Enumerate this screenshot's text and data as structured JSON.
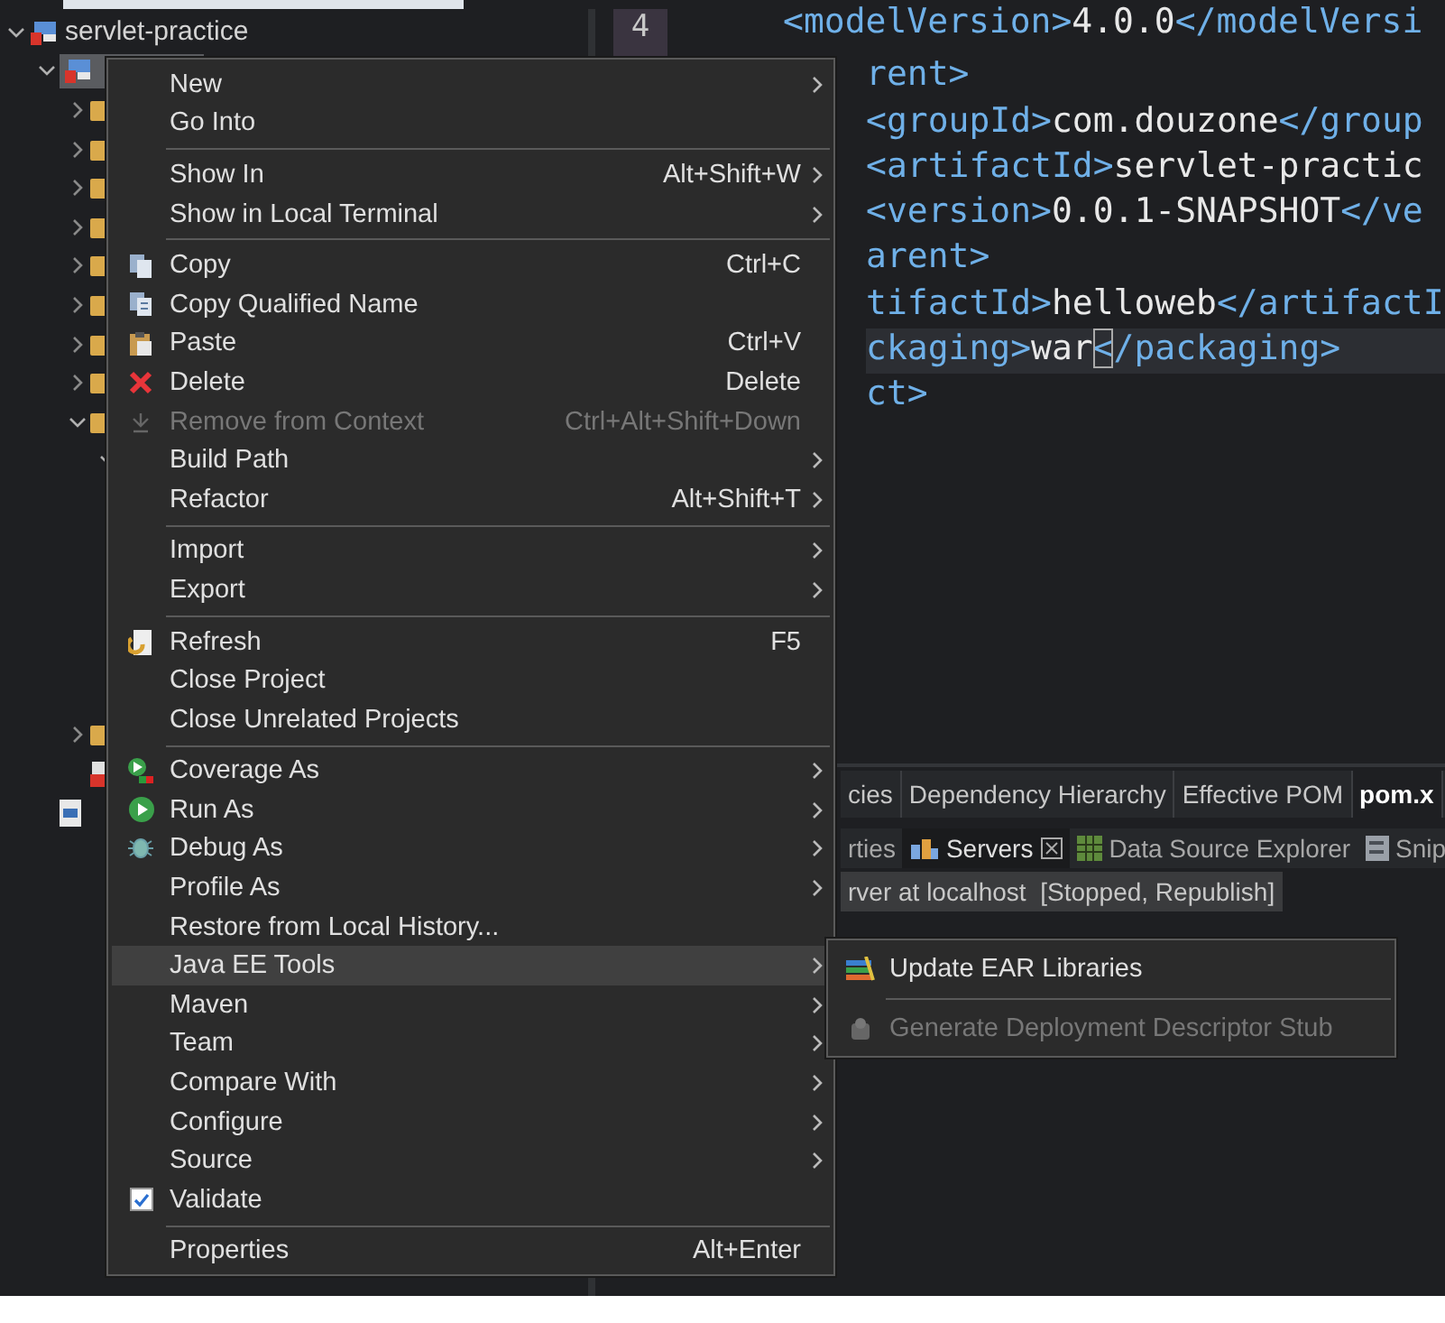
{
  "explorer": {
    "tree": [
      {
        "label": "servlet-practice",
        "expanded": true,
        "selected": false,
        "children": [
          {
            "expanded": true,
            "selected": true,
            "children": [
              {
                "expanded": false,
                "selected": false
              },
              {
                "expanded": false,
                "selected": false
              },
              {
                "expanded": false,
                "selected": false
              },
              {
                "expanded": false,
                "selected": false
              },
              {
                "expanded": false,
                "selected": false
              },
              {
                "expanded": false,
                "selected": false
              },
              {
                "expanded": false,
                "selected": false
              },
              {
                "expanded": false,
                "selected": false
              },
              {
                "expanded": true,
                "selected": false,
                "children": [
                  {
                    "expanded": true,
                    "selected": false
                  }
                ]
              },
              {
                "expanded": false,
                "selected": false
              },
              {
                "kind": "file",
                "selected": false
              }
            ]
          },
          {
            "kind": "pom",
            "selected": false
          }
        ]
      }
    ]
  },
  "editor": {
    "line_numbers": [
      "4"
    ],
    "lines": [
      {
        "current": false,
        "segments": [
          {
            "kind": "tag",
            "text": "<modelVersion>"
          },
          {
            "kind": "text",
            "text": "4.0.0"
          },
          {
            "kind": "tag",
            "text": "</modelVersi"
          }
        ]
      },
      {
        "current": false,
        "segments": [
          {
            "kind": "tag",
            "text": "rent>"
          }
        ]
      },
      {
        "current": false,
        "segments": [
          {
            "kind": "tag",
            "text": "<groupId>"
          },
          {
            "kind": "text",
            "text": "com.douzone"
          },
          {
            "kind": "tag",
            "text": "</group"
          }
        ]
      },
      {
        "current": false,
        "segments": [
          {
            "kind": "tag",
            "text": "<artifactId>"
          },
          {
            "kind": "text",
            "text": "servlet-practic"
          }
        ]
      },
      {
        "current": false,
        "segments": [
          {
            "kind": "tag",
            "text": "<version>"
          },
          {
            "kind": "text",
            "text": "0.0.1-SNAPSHOT"
          },
          {
            "kind": "tag",
            "text": "</ve"
          }
        ]
      },
      {
        "current": false,
        "segments": [
          {
            "kind": "tag",
            "text": "arent>"
          }
        ]
      },
      {
        "current": false,
        "segments": [
          {
            "kind": "tag",
            "text": "tifactId>"
          },
          {
            "kind": "text",
            "text": "helloweb"
          },
          {
            "kind": "tag",
            "text": "</artifactI"
          }
        ]
      },
      {
        "current": true,
        "segments": [
          {
            "kind": "tag",
            "text": "ckaging>"
          },
          {
            "kind": "text",
            "text": "war"
          },
          {
            "kind": "caret",
            "text": "<"
          },
          {
            "kind": "tag",
            "text": "/packaging>"
          }
        ]
      },
      {
        "current": false,
        "segments": [
          {
            "kind": "tag",
            "text": "ct>"
          }
        ]
      }
    ]
  },
  "panel": {
    "tabs": [
      {
        "label": "cies",
        "selected": false
      },
      {
        "label": "Dependency Hierarchy",
        "selected": false
      },
      {
        "label": "Effective POM",
        "selected": false
      },
      {
        "label": "pom.x",
        "selected": true
      }
    ],
    "views": [
      {
        "label": "rties",
        "selected": false,
        "closable": false
      },
      {
        "label": "Servers",
        "selected": true,
        "closable": true
      },
      {
        "label": "Data Source Explorer",
        "selected": false,
        "closable": false
      },
      {
        "label": "Snip",
        "selected": false,
        "closable": false
      }
    ],
    "server": {
      "label": "rver at localhost  [Stopped, Republish]",
      "selected": true
    }
  },
  "context_menu": {
    "items": [
      {
        "kind": "item",
        "label": "New",
        "submenu": true,
        "disabled": false,
        "selected": false
      },
      {
        "kind": "item",
        "label": "Go Into",
        "submenu": false,
        "disabled": false,
        "selected": false
      },
      {
        "kind": "separator"
      },
      {
        "kind": "item",
        "label": "Show In",
        "shortcut": "Alt+Shift+W",
        "submenu": true,
        "disabled": false,
        "selected": false
      },
      {
        "kind": "item",
        "label": "Show in Local Terminal",
        "submenu": true,
        "disabled": false,
        "selected": false
      },
      {
        "kind": "separator"
      },
      {
        "kind": "item",
        "label": "Copy",
        "shortcut": "Ctrl+C",
        "submenu": false,
        "disabled": false,
        "selected": false
      },
      {
        "kind": "item",
        "label": "Copy Qualified Name",
        "submenu": false,
        "disabled": false,
        "selected": false
      },
      {
        "kind": "item",
        "label": "Paste",
        "shortcut": "Ctrl+V",
        "submenu": false,
        "disabled": false,
        "selected": false
      },
      {
        "kind": "item",
        "label": "Delete",
        "shortcut": "Delete",
        "submenu": false,
        "disabled": false,
        "selected": false
      },
      {
        "kind": "item",
        "label": "Remove from Context",
        "shortcut": "Ctrl+Alt+Shift+Down",
        "submenu": false,
        "disabled": true,
        "selected": false
      },
      {
        "kind": "item",
        "label": "Build Path",
        "submenu": true,
        "disabled": false,
        "selected": false
      },
      {
        "kind": "item",
        "label": "Refactor",
        "shortcut": "Alt+Shift+T",
        "submenu": true,
        "disabled": false,
        "selected": false
      },
      {
        "kind": "separator"
      },
      {
        "kind": "item",
        "label": "Import",
        "submenu": true,
        "disabled": false,
        "selected": false
      },
      {
        "kind": "item",
        "label": "Export",
        "submenu": true,
        "disabled": false,
        "selected": false
      },
      {
        "kind": "separator"
      },
      {
        "kind": "item",
        "label": "Refresh",
        "shortcut": "F5",
        "submenu": false,
        "disabled": false,
        "selected": false
      },
      {
        "kind": "item",
        "label": "Close Project",
        "submenu": false,
        "disabled": false,
        "selected": false
      },
      {
        "kind": "item",
        "label": "Close Unrelated Projects",
        "submenu": false,
        "disabled": false,
        "selected": false
      },
      {
        "kind": "separator"
      },
      {
        "kind": "item",
        "label": "Coverage As",
        "submenu": true,
        "disabled": false,
        "selected": false
      },
      {
        "kind": "item",
        "label": "Run As",
        "submenu": true,
        "disabled": false,
        "selected": false
      },
      {
        "kind": "item",
        "label": "Debug As",
        "submenu": true,
        "disabled": false,
        "selected": false
      },
      {
        "kind": "item",
        "label": "Profile As",
        "submenu": true,
        "disabled": false,
        "selected": false
      },
      {
        "kind": "item",
        "label": "Restore from Local History...",
        "submenu": false,
        "disabled": false,
        "selected": false
      },
      {
        "kind": "item",
        "label": "Java EE Tools",
        "submenu": true,
        "disabled": false,
        "selected": true
      },
      {
        "kind": "item",
        "label": "Maven",
        "submenu": true,
        "disabled": false,
        "selected": false
      },
      {
        "kind": "item",
        "label": "Team",
        "submenu": true,
        "disabled": false,
        "selected": false
      },
      {
        "kind": "item",
        "label": "Compare With",
        "submenu": true,
        "disabled": false,
        "selected": false
      },
      {
        "kind": "item",
        "label": "Configure",
        "submenu": true,
        "disabled": false,
        "selected": false
      },
      {
        "kind": "item",
        "label": "Source",
        "submenu": true,
        "disabled": false,
        "selected": false
      },
      {
        "kind": "check",
        "label": "Validate",
        "checked": true,
        "submenu": false,
        "disabled": false,
        "selected": false
      },
      {
        "kind": "separator"
      },
      {
        "kind": "item",
        "label": "Properties",
        "shortcut": "Alt+Enter",
        "submenu": false,
        "disabled": false,
        "selected": false
      }
    ]
  },
  "submenu": {
    "items": [
      {
        "kind": "item",
        "label": "Update EAR Libraries",
        "submenu": false,
        "disabled": false,
        "selected": false
      },
      {
        "kind": "separator"
      },
      {
        "kind": "item",
        "label": "Generate Deployment Descriptor Stub",
        "submenu": false,
        "disabled": true,
        "selected": false
      }
    ]
  }
}
